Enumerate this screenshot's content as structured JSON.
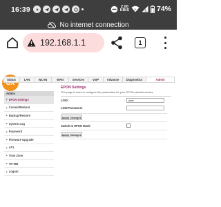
{
  "status_bar": {
    "time": "16:39",
    "net_speed_value": "2.00",
    "net_speed_unit": "KB/S",
    "battery": "74%"
  },
  "banner": {
    "text": "No internet connection"
  },
  "browser": {
    "url": "192.168.1.1",
    "tab_count": "1"
  },
  "router": {
    "logo_text": "GX",
    "nav_tabs": [
      "Status",
      "LAN",
      "WLAN",
      "WAN",
      "Services",
      "VoIP",
      "Advance",
      "Diagnostics",
      "Admin"
    ],
    "sidebar_header": "Admin",
    "sidebar_items": [
      "EPON Settings",
      "Commit/Reboot",
      "Backup/Restore",
      "System Log",
      "Password",
      "Firmware Upgrade",
      "ACL",
      "Time Zone",
      "TR-069",
      "Logout"
    ],
    "page_title": "EPON Settings",
    "page_desc": "This page is used to configure the parameters for your EPON network access.",
    "loid_label": "LOID:",
    "loid_value": "user",
    "loid_password_label": "LOID Password:",
    "loid_password_value": "",
    "apply_label_1": "Apply Changes",
    "switch_label": "Switch to EPON Mode",
    "apply_label_2": "Apply Changes"
  },
  "colors": {
    "status_bar_bg": "#3e3e3e",
    "url_bar_bg": "#fcdcdc",
    "accent": "#9b2a6a",
    "logo": "#f0921c"
  }
}
